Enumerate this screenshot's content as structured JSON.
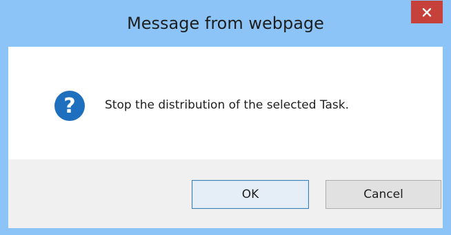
{
  "dialog": {
    "title": "Message from webpage",
    "message": "Stop the distribution of the selected Task.",
    "ok_label": "OK",
    "cancel_label": "Cancel",
    "icon": "question-icon",
    "close_icon": "close-icon"
  },
  "colors": {
    "frame": "#8cc4f8",
    "close_button": "#c7413b",
    "icon_blue": "#1f6fbf",
    "body_background": "#ffffff",
    "button_bar_background": "#f0f0f0",
    "default_button_border": "#3c7fb1"
  }
}
